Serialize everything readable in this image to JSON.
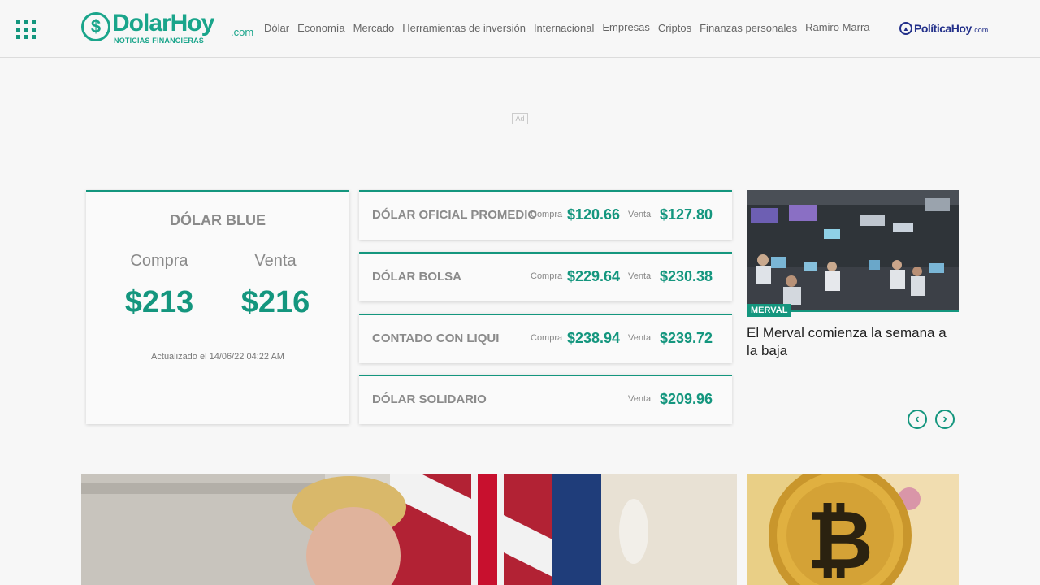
{
  "header": {
    "logo_main": "DolarHoy",
    "logo_com": ".com",
    "logo_sub": "NOTICIAS FINANCIERAS",
    "nav": [
      "Dólar",
      "Economía",
      "Mercado",
      "Herramientas de inversión",
      "Internacional",
      "Empresas",
      "Criptos",
      "Finanzas personales",
      "Ramiro Marra"
    ],
    "partner_name": "PolíticaHoy",
    "partner_com": ".com"
  },
  "ad_label": "Ad",
  "dolar_blue": {
    "title": "DÓLAR BLUE",
    "compra_label": "Compra",
    "venta_label": "Venta",
    "compra": "$213",
    "venta": "$216",
    "updated": "Actualizado el 14/06/22 04:22 AM"
  },
  "rates": [
    {
      "name": "DÓLAR OFICIAL PROMEDIO",
      "compra_label": "Compra",
      "compra": "$120.66",
      "venta_label": "Venta",
      "venta": "$127.80"
    },
    {
      "name": "DÓLAR BOLSA",
      "compra_label": "Compra",
      "compra": "$229.64",
      "venta_label": "Venta",
      "venta": "$230.38"
    },
    {
      "name": "CONTADO CON LIQUI",
      "compra_label": "Compra",
      "compra": "$238.94",
      "venta_label": "Venta",
      "venta": "$239.72"
    },
    {
      "name": "DÓLAR SOLIDARIO",
      "venta_label": "Venta",
      "venta": "$209.96"
    }
  ],
  "featured_news": {
    "tag": "MERVAL",
    "title": "El Merval comienza la semana a la baja"
  },
  "colors": {
    "accent": "#14967e",
    "partner": "#23308a"
  },
  "icons": [
    "apps-grid-icon",
    "dollar-coin-icon",
    "capitol-icon",
    "chevron-left-icon",
    "chevron-right-icon"
  ]
}
